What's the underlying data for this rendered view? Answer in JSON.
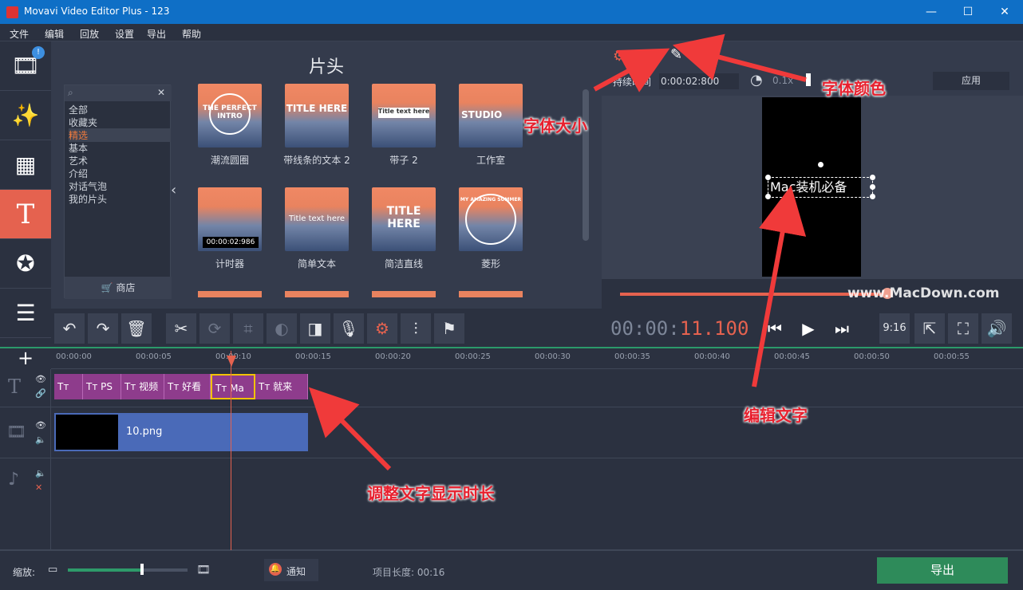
{
  "window": {
    "title": "Movavi Video Editor Plus - 123",
    "minimize": "—",
    "maximize": "☐",
    "close": "✕"
  },
  "menu": [
    "文件",
    "编辑",
    "回放",
    "设置",
    "导出",
    "帮助"
  ],
  "library": {
    "title": "片头",
    "categories": [
      "全部",
      "收藏夹",
      "精选",
      "基本",
      "艺术",
      "介绍",
      "对话气泡",
      "我的片头"
    ],
    "selected_category": "精选",
    "shop_label": "商店",
    "items": [
      {
        "label": "潮流圆圈",
        "text": "THE PERFECT INTRO"
      },
      {
        "label": "带线条的文本 2",
        "text": "TITLE HERE"
      },
      {
        "label": "带子 2",
        "text": "Title text here"
      },
      {
        "label": "工作室",
        "text": "STUDIO"
      },
      {
        "label": "计时器",
        "text": "00:00:02:986"
      },
      {
        "label": "简单文本",
        "text": "Title text here"
      },
      {
        "label": "简洁直线",
        "text": "TITLE HERE"
      },
      {
        "label": "菱形",
        "text": "MY AMAZING SUMMER"
      }
    ]
  },
  "preview": {
    "duration_label": "持续时间",
    "duration_value": "0:00:02:800",
    "speed_value": "0.1x",
    "apply_label": "应用",
    "overlay_text": "Mac装机必备"
  },
  "toolbar": {
    "timecode_main": "00:00:",
    "timecode_hot": "11.100",
    "aspect": "9:16"
  },
  "timeline": {
    "ticks": [
      "00:00:00",
      "00:00:05",
      "00:00:10",
      "00:00:15",
      "00:00:20",
      "00:00:25",
      "00:00:30",
      "00:00:35",
      "00:00:40",
      "00:00:45",
      "00:00:50",
      "00:00:55"
    ],
    "title_clips": [
      "Tт",
      "Tт PS",
      "Tт 视频",
      "Tт 好看",
      "Tт Ma",
      "Tт 就来"
    ],
    "video_clip": "10.png"
  },
  "status": {
    "zoom_label": "缩放:",
    "zoom_fraction": 0.62,
    "notify_label": "通知",
    "project_length": "项目长度: 00:16",
    "export_label": "导出"
  },
  "annotations": {
    "font_size": "字体大小",
    "font_color": "字体颜色",
    "edit_text": "编辑文字",
    "adjust_duration": "调整文字显示时长"
  },
  "watermark": "www.MacDown.com"
}
